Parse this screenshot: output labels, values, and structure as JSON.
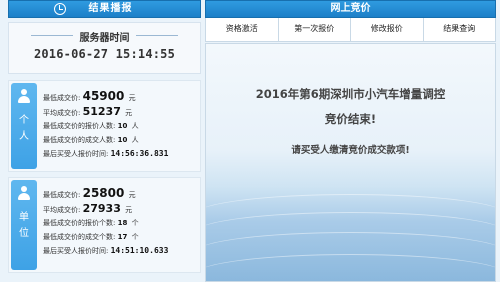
{
  "left_panel": {
    "title": "结果播报",
    "server_time_label": "服务器时间",
    "server_time": "2016-06-27 15:14:55",
    "personal": {
      "tag": "个人",
      "lowest_price_label": "最低成交价:",
      "lowest_price": "45900",
      "avg_price_label": "平均成交价:",
      "avg_price": "51237",
      "currency": "元",
      "bidders_at_lowest_label": "最低成交价的报价人数:",
      "bidders_at_lowest": "10",
      "deals_at_lowest_label": "最低成交价的成交人数:",
      "deals_at_lowest": "10",
      "count_unit": "人",
      "last_bid_time_label": "最后买受人报价时间:",
      "last_bid_time": "14:56:36.831"
    },
    "unit": {
      "tag": "单位",
      "lowest_price_label": "最低成交价:",
      "lowest_price": "25800",
      "avg_price_label": "平均成交价:",
      "avg_price": "27933",
      "currency": "元",
      "bidders_at_lowest_label": "最低成交价的报价个数:",
      "bidders_at_lowest": "18",
      "deals_at_lowest_label": "最低成交价的成交个数:",
      "deals_at_lowest": "17",
      "count_unit": "个",
      "last_bid_time_label": "最后买受人报价时间:",
      "last_bid_time": "14:51:10.633"
    }
  },
  "right_panel": {
    "title": "网上竞价",
    "tabs": [
      "资格激活",
      "第一次报价",
      "修改报价",
      "结果查询"
    ],
    "announcement_line1": "2016年第6期深圳市小汽车增量调控",
    "announcement_line2": "竞价结束!",
    "announcement_note": "请买受人缴清竞价成交款项!"
  },
  "colors": {
    "header_blue": "#1c7fc8",
    "tag_blue": "#3ea2e6",
    "page_bg": "#eaf3fa"
  },
  "icons": [
    "clock-icon",
    "person-icon"
  ]
}
